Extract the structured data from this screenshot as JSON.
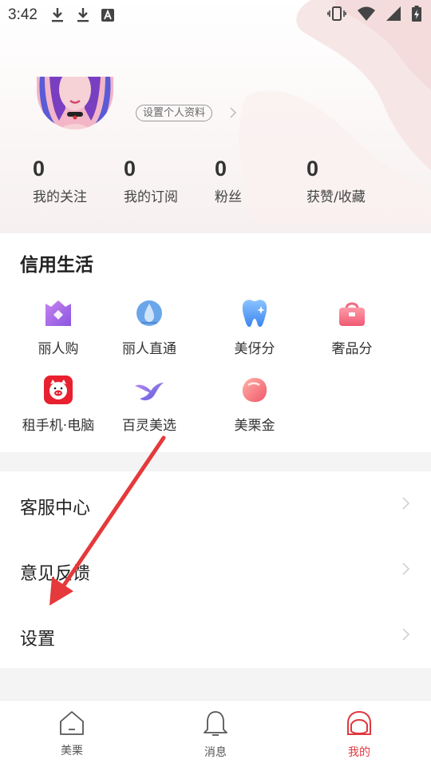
{
  "status_bar": {
    "time": "3:42",
    "icons": [
      "download-icon",
      "download-icon",
      "text-a-icon",
      "vibrate-icon",
      "wifi-icon",
      "signal-icon",
      "battery-charging-icon"
    ]
  },
  "profile": {
    "edit_label": "设置个人资料"
  },
  "stats": [
    {
      "value": "0",
      "label": "我的关注"
    },
    {
      "value": "0",
      "label": "我的订阅"
    },
    {
      "value": "0",
      "label": "粉丝"
    },
    {
      "value": "0",
      "label": "获赞/收藏"
    }
  ],
  "credit": {
    "title": "信用生活",
    "items": [
      {
        "label": "丽人购",
        "icon": "purple-gift-icon"
      },
      {
        "label": "丽人直通",
        "icon": "blue-drop-icon"
      },
      {
        "label": "美伢分",
        "icon": "tooth-icon"
      },
      {
        "label": "奢品分",
        "icon": "handbag-icon"
      },
      {
        "label": "租手机·电脑",
        "icon": "pig-icon"
      },
      {
        "label": "百灵美选",
        "icon": "bird-icon"
      },
      {
        "label": "美栗金",
        "icon": "chestnut-icon"
      }
    ]
  },
  "menu": [
    {
      "label": "客服中心"
    },
    {
      "label": "意见反馈"
    },
    {
      "label": "设置"
    }
  ],
  "nav": [
    {
      "label": "美栗",
      "icon": "home-icon"
    },
    {
      "label": "消息",
      "icon": "bell-icon"
    },
    {
      "label": "我的",
      "icon": "profile-icon"
    }
  ],
  "colors": {
    "accent": "#e0383f",
    "annotation_arrow": "#e5393b"
  }
}
